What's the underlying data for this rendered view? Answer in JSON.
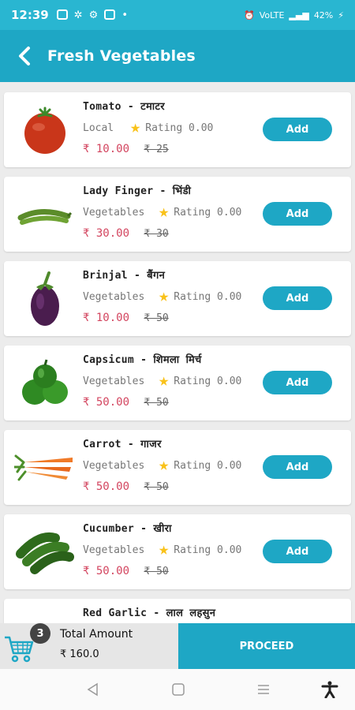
{
  "status_bar": {
    "time": "12:39",
    "battery": "42%",
    "network": "VoLTE"
  },
  "header": {
    "title": "Fresh Vegetables"
  },
  "colors": {
    "primary": "#1ea7c5",
    "price": "#d3455f",
    "star": "#f9c21a"
  },
  "products": [
    {
      "name": "Tomato - टमाटर",
      "category": "Local",
      "rating": "Rating 0.00",
      "price": "₹ 10.00",
      "old_price": "₹ 25",
      "button": "Add",
      "icon": "tomato-icon"
    },
    {
      "name": "Lady Finger - भिंडी",
      "category": "Vegetables",
      "rating": "Rating 0.00",
      "price": "₹ 30.00",
      "old_price": "₹ 30",
      "button": "Add",
      "icon": "okra-icon"
    },
    {
      "name": "Brinjal - बैंगन",
      "category": "Vegetables",
      "rating": "Rating 0.00",
      "price": "₹ 10.00",
      "old_price": "₹ 50",
      "button": "Add",
      "icon": "brinjal-icon"
    },
    {
      "name": "Capsicum - शिमला मिर्च",
      "category": "Vegetables",
      "rating": "Rating 0.00",
      "price": "₹ 50.00",
      "old_price": "₹ 50",
      "button": "Add",
      "icon": "capsicum-icon"
    },
    {
      "name": "Carrot - गाजर",
      "category": "Vegetables",
      "rating": "Rating 0.00",
      "price": "₹ 50.00",
      "old_price": "₹ 50",
      "button": "Add",
      "icon": "carrot-icon"
    },
    {
      "name": "Cucumber - खीरा",
      "category": "Vegetables",
      "rating": "Rating 0.00",
      "price": "₹ 50.00",
      "old_price": "₹ 50",
      "button": "Add",
      "icon": "cucumber-icon"
    },
    {
      "name": "Red Garlic - लाल लहसुन",
      "category": "",
      "rating": "",
      "price": "",
      "old_price": "",
      "button": "",
      "icon": ""
    }
  ],
  "cart": {
    "count": "3",
    "total_label": "Total Amount",
    "total_amount": "₹ 160.0",
    "proceed_label": "PROCEED"
  }
}
